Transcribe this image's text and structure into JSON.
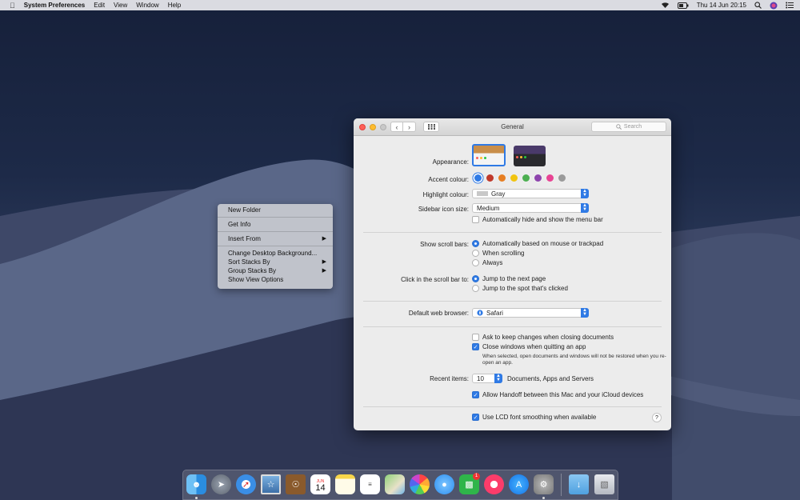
{
  "menubar": {
    "app_name": "System Preferences",
    "menus": [
      "Edit",
      "View",
      "Window",
      "Help"
    ],
    "clock": "Thu 14 Jun  20:15"
  },
  "context_menu": {
    "items": [
      "New Folder",
      "Get Info",
      "Insert From",
      "Change Desktop Background...",
      "Sort Stacks By",
      "Group Stacks By",
      "Show View Options"
    ]
  },
  "window": {
    "title": "General",
    "search_placeholder": "Search",
    "appearance_label": "Appearance:",
    "accent_label": "Accent colour:",
    "accent_colors": [
      "#2f7ae5",
      "#c0392b",
      "#e67e22",
      "#f1c40f",
      "#4caf50",
      "#8e44ad",
      "#e84393",
      "#9a9a9a"
    ],
    "highlight_label": "Highlight colour:",
    "highlight_value": "Gray",
    "sidebar_label": "Sidebar icon size:",
    "sidebar_value": "Medium",
    "auto_hide_menu": "Automatically hide and show the menu bar",
    "scroll_bars_label": "Show scroll bars:",
    "scroll_options": [
      "Automatically based on mouse or trackpad",
      "When scrolling",
      "Always"
    ],
    "click_scroll_label": "Click in the scroll bar to:",
    "click_options": [
      "Jump to the next page",
      "Jump to the spot that's clicked"
    ],
    "browser_label": "Default web browser:",
    "browser_value": "Safari",
    "ask_keep_changes": "Ask to keep changes when closing documents",
    "close_windows": "Close windows when quitting an app",
    "close_windows_note": "When selected, open documents and windows will not be restored when you re-open an app.",
    "recent_label": "Recent items:",
    "recent_value": "10",
    "recent_suffix": "Documents, Apps and Servers",
    "handoff": "Allow Handoff between this Mac and your iCloud devices",
    "lcd_smoothing": "Use LCD font smoothing when available",
    "help": "?"
  },
  "dock": {
    "calendar_month": "JUN",
    "calendar_day": "14",
    "facetime_badge": "1"
  }
}
